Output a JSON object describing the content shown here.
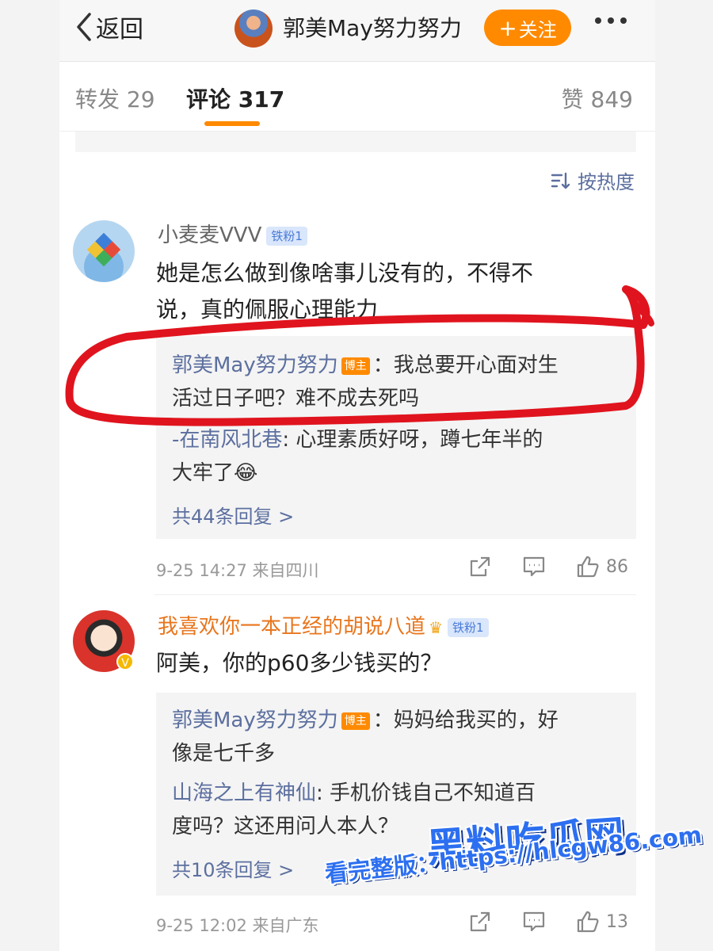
{
  "nav": {
    "back_label": "返回",
    "title": "郭美May努力努力",
    "follow_label": "关注",
    "follow_plus": "+"
  },
  "tabs": {
    "repost": "转发 29",
    "comment": "评论 317",
    "like": "赞 849"
  },
  "sort_label": "按热度",
  "comments": [
    {
      "user": "小麦麦VVV",
      "fan_badge": "铁粉1",
      "text_line1": "她是怎么做到像啥事儿没有的，不得不",
      "text_line2": "说，真的佩服心理能力",
      "replies": [
        {
          "name": "郭美May努力努力",
          "host_tag": "博主",
          "line1": "：我总要开心面对生",
          "line2": "活过日子吧？难不成去死吗"
        },
        {
          "name": "-在南风北巷",
          "line1": ": 心理素质好呀，蹲七年半的",
          "line2": "大牢了😂"
        }
      ],
      "more_replies": "共44条回复 >",
      "meta": "9-25 14:27  来自四川",
      "likes": "86"
    },
    {
      "user": "我喜欢你一本正经的胡说八道",
      "fan_badge": "铁粉1",
      "text_line1": "阿美，你的p60多少钱买的？",
      "replies": [
        {
          "name": "郭美May努力努力",
          "host_tag": "博主",
          "line1": "：妈妈给我买的，好",
          "line2": "像是七千多"
        },
        {
          "name": "山海之上有神仙",
          "line1": ": 手机价钱自己不知道百",
          "line2": "度吗？这还用问人本人？"
        }
      ],
      "more_replies": "共10条回复 >",
      "meta": "9-25 12:02  来自广东",
      "likes": "13"
    }
  ],
  "watermark": {
    "brand": "黑料吃瓜网",
    "url": "看完整版：https://hlcgw86.com"
  },
  "colors": {
    "accent": "#ff8a00",
    "link": "#5c6f9f",
    "annotation": "#e0141e"
  }
}
